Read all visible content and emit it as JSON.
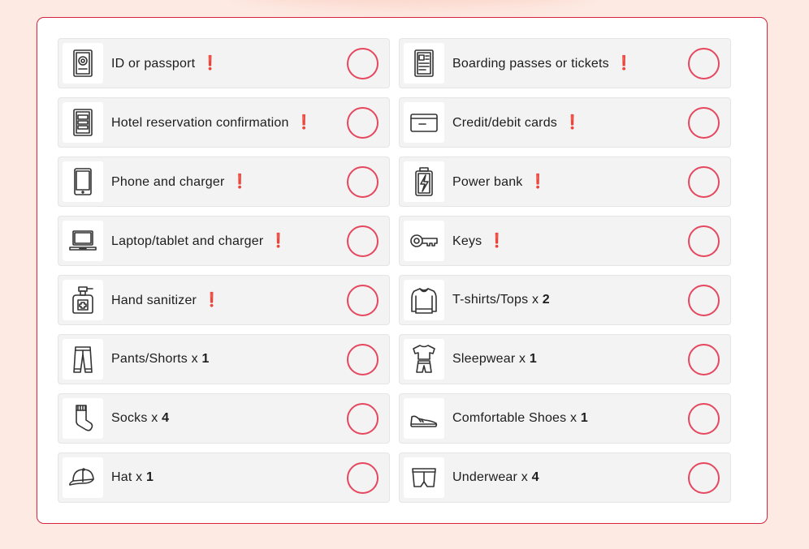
{
  "checklist": {
    "items": [
      {
        "label": "ID or passport",
        "icon": "passport-icon",
        "important": "❗",
        "qty_prefix": "",
        "qty": ""
      },
      {
        "label": "Boarding passes or tickets",
        "icon": "ticket-icon",
        "important": "❗",
        "qty_prefix": "",
        "qty": ""
      },
      {
        "label": "Hotel reservation confirmation",
        "icon": "document-icon",
        "important": "❗",
        "qty_prefix": "",
        "qty": ""
      },
      {
        "label": "Credit/debit cards",
        "icon": "credit-card-icon",
        "important": "❗",
        "qty_prefix": "",
        "qty": ""
      },
      {
        "label": "Phone and charger",
        "icon": "phone-icon",
        "important": "❗",
        "qty_prefix": "",
        "qty": ""
      },
      {
        "label": "Power bank",
        "icon": "power-bank-icon",
        "important": "❗",
        "qty_prefix": "",
        "qty": ""
      },
      {
        "label": "Laptop/tablet and charger",
        "icon": "laptop-icon",
        "important": "❗",
        "qty_prefix": "",
        "qty": ""
      },
      {
        "label": "Keys",
        "icon": "key-icon",
        "important": "❗",
        "qty_prefix": "",
        "qty": ""
      },
      {
        "label": "Hand sanitizer",
        "icon": "sanitizer-icon",
        "important": "❗",
        "qty_prefix": "",
        "qty": ""
      },
      {
        "label": "T-shirts/Tops",
        "icon": "sweater-icon",
        "important": "",
        "qty_prefix": " x ",
        "qty": "2"
      },
      {
        "label": "Pants/Shorts",
        "icon": "pants-icon",
        "important": "",
        "qty_prefix": " x ",
        "qty": "1"
      },
      {
        "label": "Sleepwear",
        "icon": "sleepwear-icon",
        "important": "",
        "qty_prefix": " x ",
        "qty": "1"
      },
      {
        "label": "Socks",
        "icon": "sock-icon",
        "important": "",
        "qty_prefix": " x ",
        "qty": "4"
      },
      {
        "label": "Comfortable Shoes",
        "icon": "shoe-icon",
        "important": "",
        "qty_prefix": " x ",
        "qty": "1"
      },
      {
        "label": "Hat",
        "icon": "cap-icon",
        "important": "",
        "qty_prefix": " x ",
        "qty": "1"
      },
      {
        "label": "Underwear",
        "icon": "underwear-icon",
        "important": "",
        "qty_prefix": " x ",
        "qty": "4"
      }
    ]
  },
  "colors": {
    "accent": "#e5475e",
    "important": "#e0142c",
    "background": "#fdeae2",
    "row": "#f3f3f3"
  }
}
